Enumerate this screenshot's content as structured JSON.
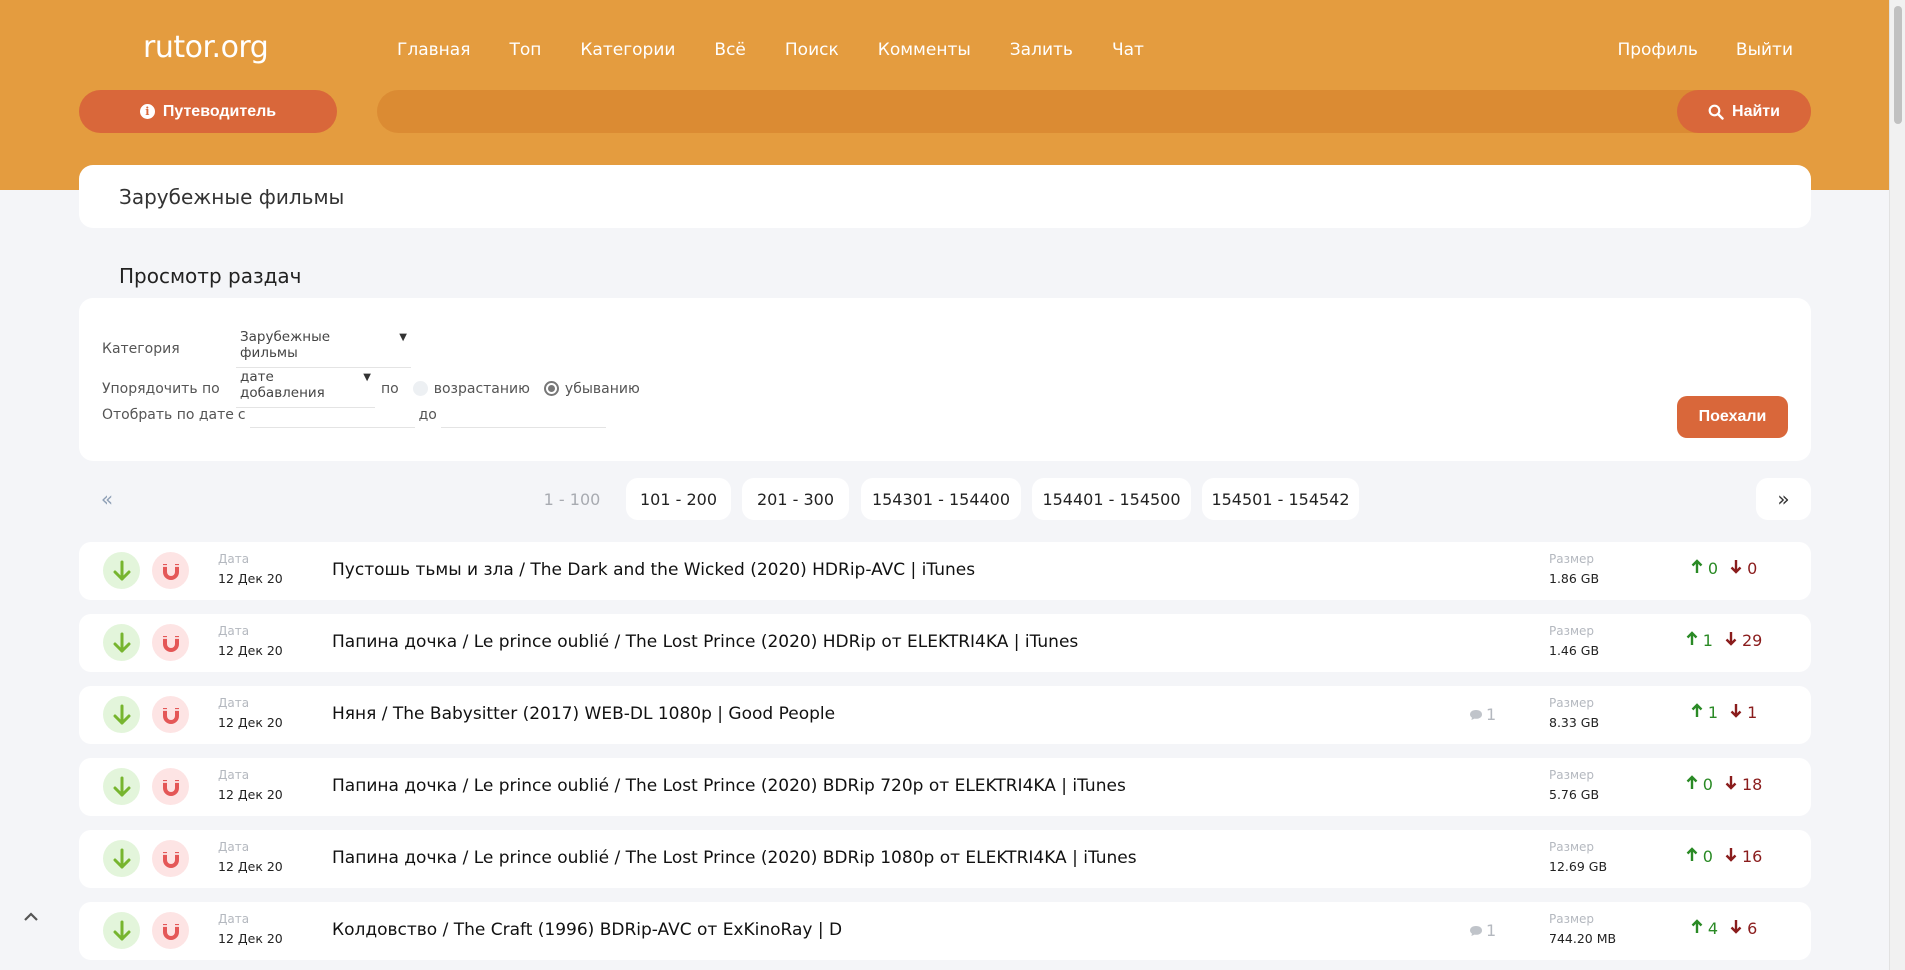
{
  "header": {
    "logo": "rutor.org",
    "nav": [
      "Главная",
      "Топ",
      "Категории",
      "Всё",
      "Поиск",
      "Комменты",
      "Залить",
      "Чат"
    ],
    "nav_right": [
      "Профиль",
      "Выйти"
    ],
    "guide_label": "Путеводитель",
    "search_value": "",
    "search_label": "Найти"
  },
  "section_title": "Зарубежные фильмы",
  "subheading": "Просмотр раздач",
  "filters": {
    "category_label": "Категория",
    "category_value": "Зарубежные фильмы",
    "order_label": "Упорядочить по",
    "order_value": "дате добавления",
    "order_by_word": "по",
    "asc_label": "возрастанию",
    "desc_label": "убыванию",
    "date_label": "Отобрать по дате",
    "date_from": "с",
    "date_to": "до",
    "go_label": "Поехали"
  },
  "pagination": {
    "prev": "«",
    "next": "»",
    "current": "1 - 100",
    "pages": [
      "101 - 200",
      "201 - 300",
      "154301 - 154400",
      "154401 - 154500",
      "154501 - 154542"
    ]
  },
  "labels": {
    "date": "Дата",
    "size": "Размер"
  },
  "torrents": [
    {
      "date": "12 Дек 20",
      "title": "Пустошь тьмы и зла / The Dark and the Wicked (2020) HDRip-AVC | iTunes",
      "comments": "",
      "size": "1.86 GB",
      "seeders": "0",
      "leechers": "0"
    },
    {
      "date": "12 Дек 20",
      "title": "Папина дочка / Le prince oublié / The Lost Prince (2020) HDRip от ELEKTRI4KA | iTunes",
      "comments": "",
      "size": "1.46 GB",
      "seeders": "1",
      "leechers": "29"
    },
    {
      "date": "12 Дек 20",
      "title": "Няня / The Babysitter (2017) WEB-DL 1080p | Good People",
      "comments": "1",
      "size": "8.33 GB",
      "seeders": "1",
      "leechers": "1"
    },
    {
      "date": "12 Дек 20",
      "title": "Папина дочка / Le prince oublié / The Lost Prince (2020) BDRip 720p от ELEKTRI4KA | iTunes",
      "comments": "",
      "size": "5.76 GB",
      "seeders": "0",
      "leechers": "18"
    },
    {
      "date": "12 Дек 20",
      "title": "Папина дочка / Le prince oublié / The Lost Prince (2020) BDRip 1080p от ELEKTRI4KA | iTunes",
      "comments": "",
      "size": "12.69 GB",
      "seeders": "0",
      "leechers": "16"
    },
    {
      "date": "12 Дек 20",
      "title": "Колдовство / The Craft (1996) BDRip-AVC от ExKinoRay | D",
      "comments": "1",
      "size": "744.20 MB",
      "seeders": "4",
      "leechers": "6"
    }
  ],
  "colors": {
    "header": "#e49c3f",
    "accent": "#d9673a",
    "seed": "#2a8a25",
    "leech": "#8a1c1c"
  }
}
